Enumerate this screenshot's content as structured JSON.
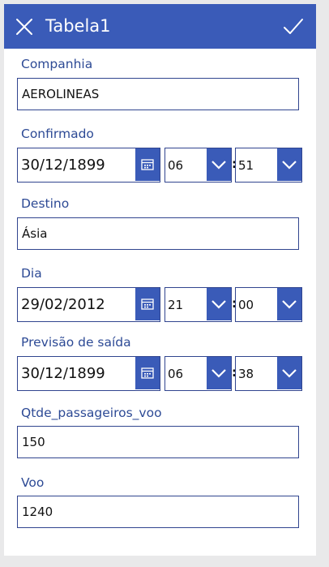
{
  "header": {
    "title": "Tabela1"
  },
  "icons": {
    "close": "close-icon",
    "confirm": "checkmark-icon",
    "calendar": "calendar-icon",
    "dropdown": "chevron-down-icon"
  },
  "colors": {
    "accent": "#3a5bb8",
    "border": "#31458f",
    "label": "#2d4a95",
    "background": "#e9e9ea"
  },
  "fields": {
    "companhia": {
      "label": "Companhia",
      "value": "AEROLINEAS"
    },
    "confirmado": {
      "label": "Confirmado",
      "date": "30/12/1899",
      "hour": "06",
      "minute": "51"
    },
    "destino": {
      "label": "Destino",
      "value": "Ásia"
    },
    "dia": {
      "label": "Dia",
      "date": "29/02/2012",
      "hour": "21",
      "minute": "00"
    },
    "previsao": {
      "label": "Previsão de saída",
      "date": "30/12/1899",
      "hour": "06",
      "minute": "38"
    },
    "qtde": {
      "label": "Qtde_passageiros_voo",
      "value": "150"
    },
    "voo": {
      "label": "Voo",
      "value": "1240"
    }
  },
  "separator": ":"
}
